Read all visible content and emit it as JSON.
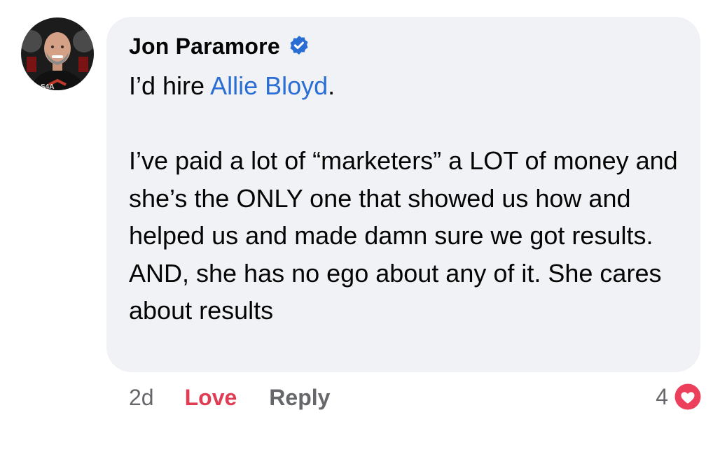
{
  "comment": {
    "author": "Jon Paramore",
    "verified": true,
    "greeting_prefix": "I’d hire ",
    "mention": "Allie Bloyd",
    "greeting_suffix": ".",
    "body": "I’ve paid a lot of “marketers” a LOT of money and she’s the ONLY one that showed us how and helped us and made damn sure we got results. AND, she has no ego about any of it. She cares about results",
    "avatar_shirt_text": "S4A"
  },
  "actions": {
    "time": "2d",
    "love_label": "Love",
    "reply_label": "Reply"
  },
  "reactions": {
    "count": "4",
    "icon": "heart-icon"
  },
  "colors": {
    "bubble_bg": "#f0f2f5",
    "mention": "#2a6ed4",
    "love": "#e03d55",
    "verified": "#2a6ed4",
    "muted": "#65676b"
  }
}
